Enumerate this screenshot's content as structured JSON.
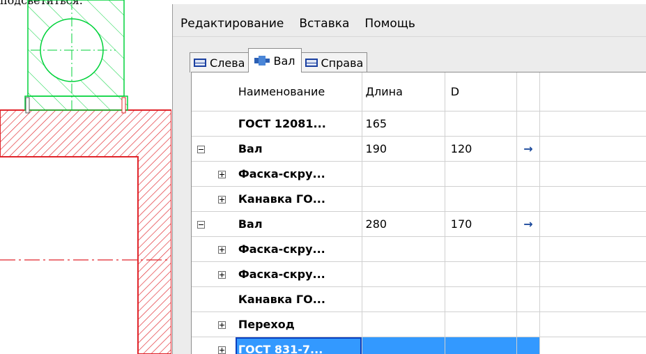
{
  "caption": "подсветиться.",
  "menu": {
    "items": [
      "Редактирование",
      "Вставка",
      "Помощь"
    ]
  },
  "tabs": [
    {
      "label": "Слева",
      "icon": "left-view-icon",
      "active": false
    },
    {
      "label": "Вал",
      "icon": "shaft-icon",
      "active": true
    },
    {
      "label": "Справа",
      "icon": "right-view-icon",
      "active": false
    }
  ],
  "table": {
    "headers": {
      "name": "Наименование",
      "length": "Длина",
      "d": "D"
    },
    "rows": [
      {
        "level": 0,
        "expander": "",
        "name": "ГОСТ 12081...",
        "length": "165",
        "d": "",
        "arrow": ""
      },
      {
        "level": 0,
        "expander": "collapse",
        "name": "Вал",
        "length": "190",
        "d": "120",
        "arrow": "→"
      },
      {
        "level": 1,
        "expander": "expand",
        "name": "Фаска-скру...",
        "length": "",
        "d": "",
        "arrow": ""
      },
      {
        "level": 1,
        "expander": "expand",
        "name": "Канавка ГО...",
        "length": "",
        "d": "",
        "arrow": ""
      },
      {
        "level": 0,
        "expander": "collapse",
        "name": "Вал",
        "length": "280",
        "d": "170",
        "arrow": "→"
      },
      {
        "level": 1,
        "expander": "expand",
        "name": "Фаска-скру...",
        "length": "",
        "d": "",
        "arrow": ""
      },
      {
        "level": 1,
        "expander": "expand",
        "name": "Фаска-скру...",
        "length": "",
        "d": "",
        "arrow": ""
      },
      {
        "level": 1,
        "expander": "",
        "name": "Канавка ГО...",
        "length": "",
        "d": "",
        "arrow": ""
      },
      {
        "level": 1,
        "expander": "expand",
        "name": "Переход",
        "length": "",
        "d": "",
        "arrow": ""
      },
      {
        "level": 1,
        "expander": "expand",
        "name": "ГОСТ 831-7...",
        "length": "",
        "d": "",
        "arrow": "",
        "selected": true
      }
    ]
  },
  "colors": {
    "selection": "#3399ff",
    "cad_part": "#e0242a",
    "cad_green": "#00d23a"
  }
}
